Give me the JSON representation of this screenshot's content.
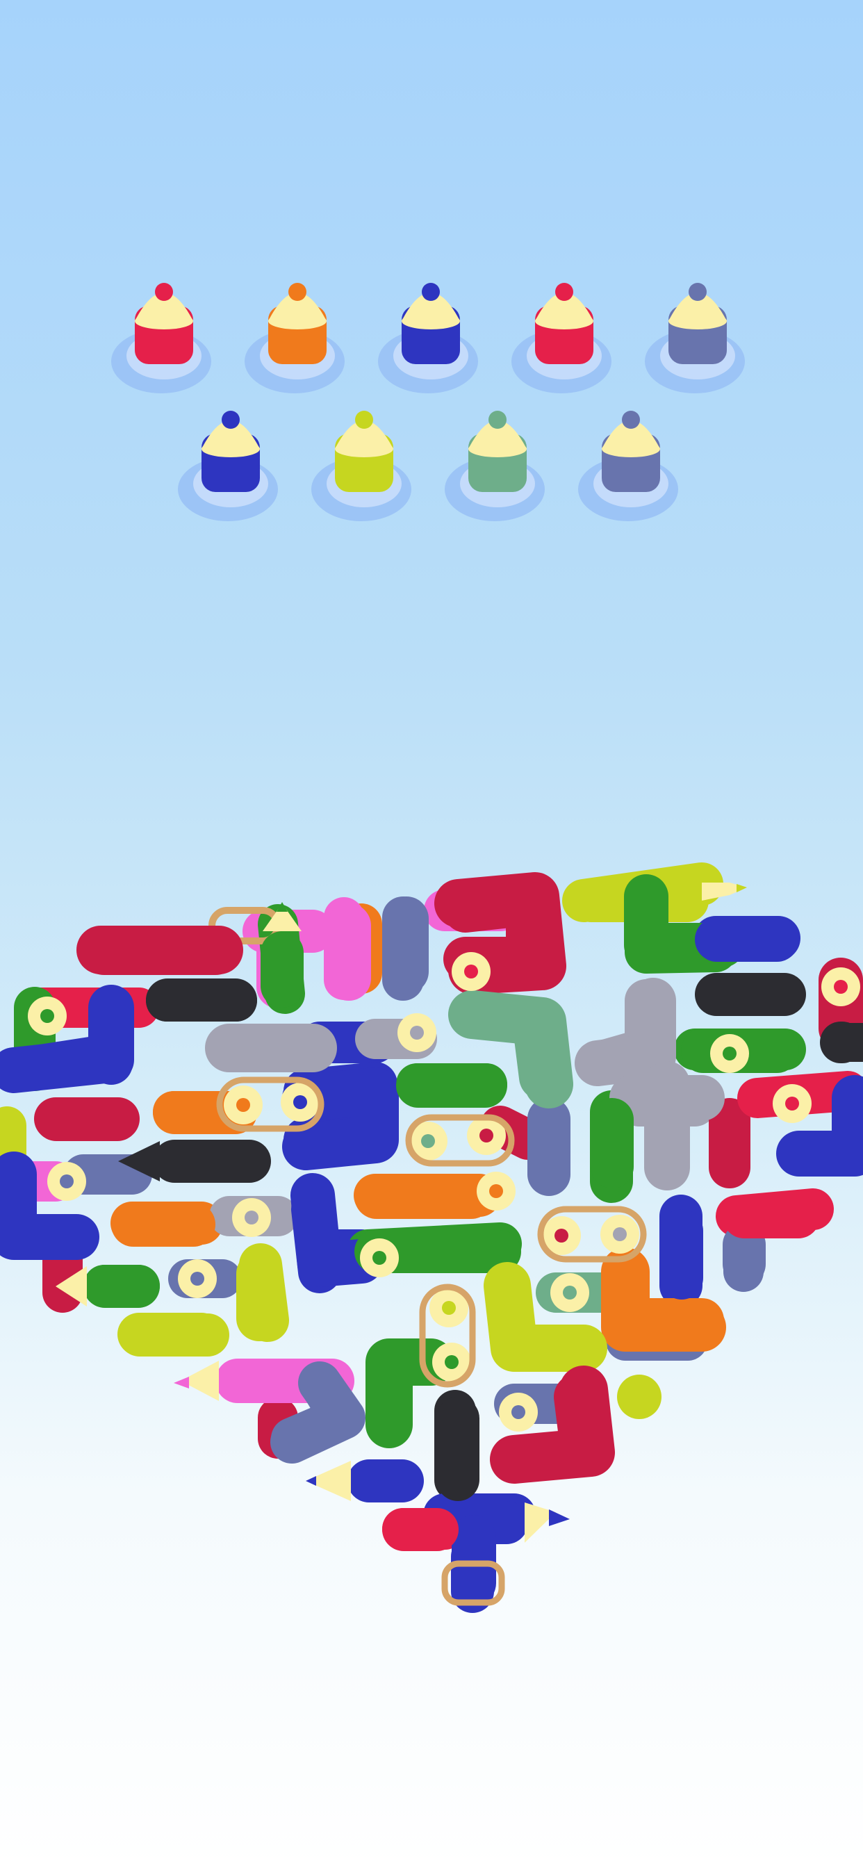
{
  "colors": {
    "red": "#e5204a",
    "crimson": "#c81c44",
    "orange": "#f07a1c",
    "blue": "#2e35c0",
    "slate": "#6874ad",
    "lime": "#c6d620",
    "green": "#2f9a2b",
    "mint": "#6eae8a",
    "pink": "#f266d6",
    "gray": "#a3a3b3",
    "black": "#2c2c31",
    "cream": "#fbf0a8",
    "rope": "#d6a468",
    "slot": "#9cc4f6",
    "slotInner": "#c4dbfb"
  },
  "slots": {
    "row1": [
      "red",
      "orange",
      "blue",
      "red",
      "slate"
    ],
    "row2": [
      "blue",
      "lime",
      "mint",
      "slate"
    ]
  },
  "board": {
    "pencils": [
      {
        "color": "lime",
        "dir": "right"
      },
      {
        "color": "green",
        "dir": "up"
      },
      {
        "color": "black",
        "dir": "left"
      },
      {
        "color": "green",
        "dir": "left"
      },
      {
        "color": "pink",
        "dir": "left"
      },
      {
        "color": "blue",
        "dir": "left"
      },
      {
        "color": "blue",
        "dir": "right"
      }
    ]
  }
}
